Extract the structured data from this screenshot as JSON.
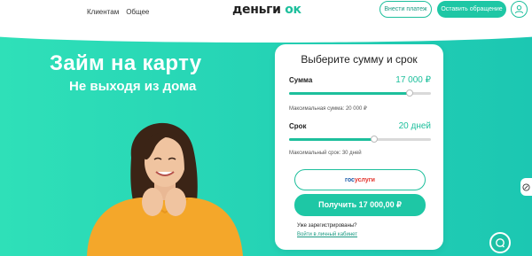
{
  "header": {
    "nav": [
      "Клиентам",
      "Общее"
    ],
    "logo_main": "деньги",
    "logo_accent": "ок",
    "pay_button": "Внести платеж",
    "appeal_button": "Оставить обращение",
    "user_icon": "user-icon"
  },
  "hero": {
    "title": "Займ на карту",
    "subtitle": "Не выходя из дома"
  },
  "calculator": {
    "title": "Выберите сумму и срок",
    "amount": {
      "label": "Сумма",
      "value": "17 000 ₽",
      "fraction": 0.85,
      "hint": "Максимальная сумма: 20 000 ₽"
    },
    "term": {
      "label": "Срок",
      "value": "20 дней",
      "fraction": 0.6,
      "hint": "Максимальный срок: 30 дней"
    },
    "gosuslugi_part1": "гос",
    "gosuslugi_part2": "услуги",
    "get_button": "Получить 17 000,00 ₽",
    "registered_question": "Уже зарегистрированы?",
    "login_link": "Войти в личный кабинет"
  },
  "colors": {
    "accent": "#1dbf9c",
    "hero_gradient_start": "#2fe0b8",
    "hero_gradient_end": "#1cc7b2"
  },
  "icons": {
    "side_tab": "accessibility-icon",
    "chat": "chat-icon"
  }
}
